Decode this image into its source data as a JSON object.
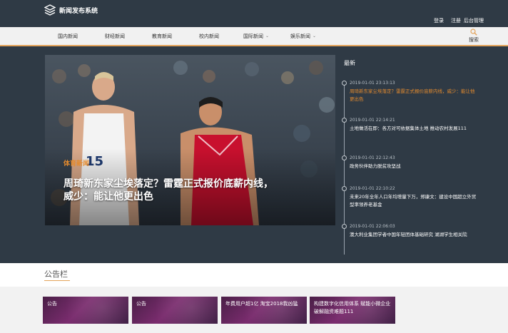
{
  "header": {
    "title": "新闻发布系统",
    "login": "登录",
    "register": "注册",
    "admin": "后台管理"
  },
  "nav": {
    "items": [
      {
        "label": "国内新闻",
        "has_dropdown": false
      },
      {
        "label": "财经新闻",
        "has_dropdown": false
      },
      {
        "label": "教育新闻",
        "has_dropdown": false
      },
      {
        "label": "校内新闻",
        "has_dropdown": false
      },
      {
        "label": "国际新闻",
        "has_dropdown": true
      },
      {
        "label": "娱乐新闻",
        "has_dropdown": true
      }
    ],
    "search_label": "搜索"
  },
  "hero": {
    "category": "体育新闻",
    "title": "周琦新东家尘埃落定？雷霆正式报价底薪内线，威少：能让他更出色"
  },
  "latest": {
    "heading": "最新",
    "items": [
      {
        "time": "2019-01-01 23:13:13",
        "text": "周琦新东家尘埃落定？雷霆正式报价底薪内线，威少：能让他更出色",
        "active": true
      },
      {
        "time": "2019-01-01 22:14:21",
        "text": "土地做活在即：各方对可依据集体土地 推动农村发展111",
        "active": false
      },
      {
        "time": "2019-01-01 22:12:43",
        "text": "政务伙伴助力脱贫攻坚战",
        "active": false
      },
      {
        "time": "2019-01-01 22:10:22",
        "text": "未来20年全年人口年均增量下万，郑康文：建设中国超立外贸型率领养老基金",
        "active": false
      },
      {
        "time": "2019-01-01 22:06:03",
        "text": "澳大利业集团学者中国年轻团体基础研究 湖湖学生相关院",
        "active": false
      }
    ]
  },
  "notice": {
    "title": "公告栏",
    "cards": [
      "公告",
      "公告",
      "年费用户超1亿 淘宝2018我凶猛",
      "构建数字化信用体系 赋能小微企业破解融资难题111"
    ]
  },
  "colors": {
    "header_bg": "#2f3a45",
    "accent": "#e3a35a",
    "active_text": "#e58b2e",
    "card_bg": "#5a2456"
  }
}
